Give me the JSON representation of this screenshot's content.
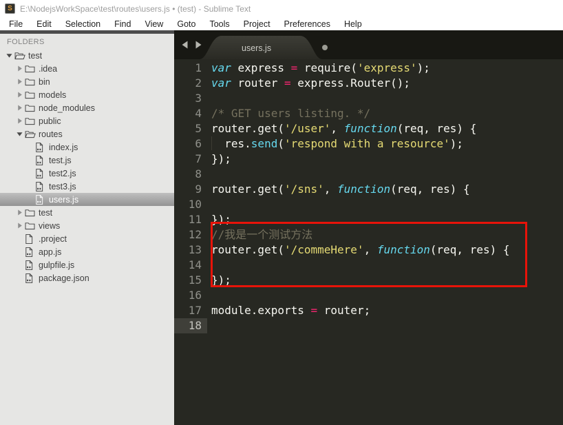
{
  "window": {
    "title": "E:\\NodejsWorkSpace\\test\\routes\\users.js • (test) - Sublime Text",
    "app_icon_letter": "S"
  },
  "menu": {
    "items": [
      "File",
      "Edit",
      "Selection",
      "Find",
      "View",
      "Goto",
      "Tools",
      "Project",
      "Preferences",
      "Help"
    ]
  },
  "sidebar": {
    "header": "FOLDERS",
    "tree": [
      {
        "label": "test",
        "depth": 0,
        "kind": "folder-open",
        "expanded": true
      },
      {
        "label": ".idea",
        "depth": 1,
        "kind": "folder",
        "expanded": false
      },
      {
        "label": "bin",
        "depth": 1,
        "kind": "folder",
        "expanded": false
      },
      {
        "label": "models",
        "depth": 1,
        "kind": "folder",
        "expanded": false
      },
      {
        "label": "node_modules",
        "depth": 1,
        "kind": "folder",
        "expanded": false
      },
      {
        "label": "public",
        "depth": 1,
        "kind": "folder",
        "expanded": false
      },
      {
        "label": "routes",
        "depth": 1,
        "kind": "folder-open",
        "expanded": true
      },
      {
        "label": "index.js",
        "depth": 2,
        "kind": "file-js"
      },
      {
        "label": "test.js",
        "depth": 2,
        "kind": "file-js"
      },
      {
        "label": "test2.js",
        "depth": 2,
        "kind": "file-js"
      },
      {
        "label": "test3.js",
        "depth": 2,
        "kind": "file-js"
      },
      {
        "label": "users.js",
        "depth": 2,
        "kind": "file-js",
        "selected": true
      },
      {
        "label": "test",
        "depth": 1,
        "kind": "folder",
        "expanded": false
      },
      {
        "label": "views",
        "depth": 1,
        "kind": "folder",
        "expanded": false
      },
      {
        "label": ".project",
        "depth": 1,
        "kind": "file"
      },
      {
        "label": "app.js",
        "depth": 1,
        "kind": "file-js"
      },
      {
        "label": "gulpfile.js",
        "depth": 1,
        "kind": "file-js"
      },
      {
        "label": "package.json",
        "depth": 1,
        "kind": "file-js"
      }
    ]
  },
  "tabbar": {
    "active_tab": {
      "label": "users.js",
      "modified": true
    }
  },
  "editor": {
    "language": "JavaScript",
    "lines": [
      {
        "num": 1,
        "tokens": [
          [
            "kw",
            "var"
          ],
          [
            "pl",
            " express "
          ],
          [
            "op",
            "="
          ],
          [
            "pl",
            " require("
          ],
          [
            "str",
            "'express'"
          ],
          [
            "pl",
            ");"
          ]
        ]
      },
      {
        "num": 2,
        "tokens": [
          [
            "kw",
            "var"
          ],
          [
            "pl",
            " router "
          ],
          [
            "op",
            "="
          ],
          [
            "pl",
            " express.Router();"
          ]
        ]
      },
      {
        "num": 3,
        "tokens": []
      },
      {
        "num": 4,
        "tokens": [
          [
            "cmt",
            "/* GET users listing. */"
          ]
        ]
      },
      {
        "num": 5,
        "tokens": [
          [
            "pl",
            "router.get("
          ],
          [
            "str",
            "'/user'"
          ],
          [
            "pl",
            ", "
          ],
          [
            "kw",
            "function"
          ],
          [
            "pl",
            "(req, res) {"
          ]
        ]
      },
      {
        "num": 6,
        "tokens": [
          [
            "g",
            "  "
          ],
          [
            "pl",
            "res."
          ],
          [
            "fn",
            "send"
          ],
          [
            "pl",
            "("
          ],
          [
            "str",
            "'respond with a resource'"
          ],
          [
            "pl",
            ");"
          ]
        ]
      },
      {
        "num": 7,
        "tokens": [
          [
            "pl",
            "});"
          ]
        ]
      },
      {
        "num": 8,
        "tokens": []
      },
      {
        "num": 9,
        "tokens": [
          [
            "pl",
            "router.get("
          ],
          [
            "str",
            "'/sns'"
          ],
          [
            "pl",
            ", "
          ],
          [
            "kw",
            "function"
          ],
          [
            "pl",
            "(req, res) {"
          ]
        ]
      },
      {
        "num": 10,
        "tokens": []
      },
      {
        "num": 11,
        "tokens": [
          [
            "pl",
            "});"
          ]
        ]
      },
      {
        "num": 12,
        "tokens": [
          [
            "cmt",
            "//我是一个测试方法"
          ]
        ]
      },
      {
        "num": 13,
        "tokens": [
          [
            "pl",
            "router.get("
          ],
          [
            "str",
            "'/commeHere'"
          ],
          [
            "pl",
            ", "
          ],
          [
            "kw",
            "function"
          ],
          [
            "pl",
            "(req, res) {"
          ]
        ]
      },
      {
        "num": 14,
        "tokens": []
      },
      {
        "num": 15,
        "tokens": [
          [
            "pl",
            "});"
          ]
        ]
      },
      {
        "num": 16,
        "tokens": []
      },
      {
        "num": 17,
        "tokens": [
          [
            "pl",
            "module.exports "
          ],
          [
            "op",
            "="
          ],
          [
            "pl",
            " router;"
          ]
        ]
      },
      {
        "num": 18,
        "tokens": [],
        "current": true
      }
    ]
  },
  "annotation": {
    "type": "red-highlight-box",
    "covers_lines": "12-15"
  },
  "colors": {
    "annotation": "#e81309",
    "kw": "#66d9ef",
    "op": "#f92672",
    "str": "#e6db74",
    "cmt": "#75715e",
    "plain": "#f8f8f2",
    "editor_bg": "#272822",
    "tabbar_bg": "#181813",
    "sidebar_bg": "#e6e6e4",
    "select_grad_top": "#bfbfbf",
    "select_grad_bottom": "#939393"
  }
}
